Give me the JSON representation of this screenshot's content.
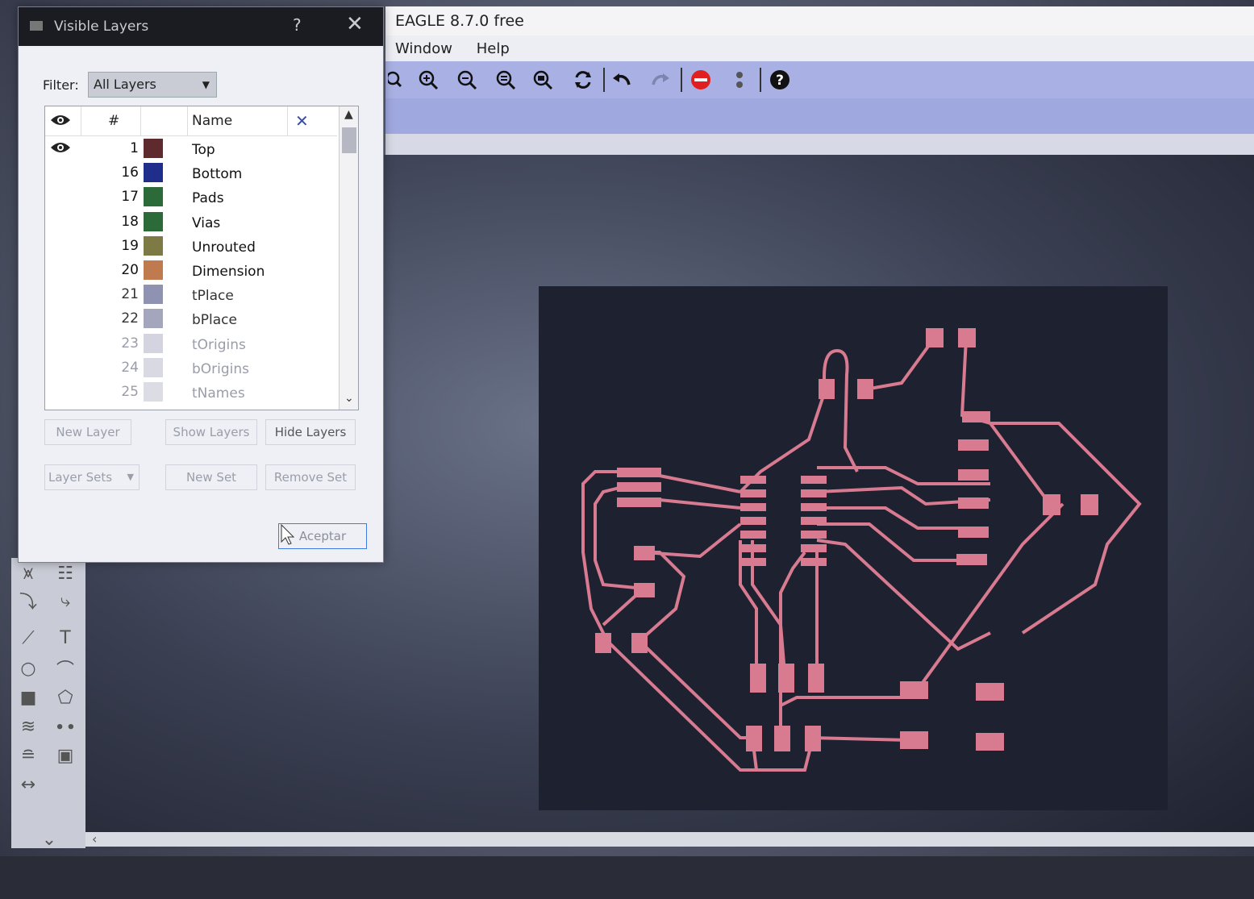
{
  "window": {
    "title": "EAGLE 8.7.0 free",
    "menu": [
      "Window",
      "Help"
    ]
  },
  "toolbar": {
    "icons": [
      "zoom-in-icon",
      "zoom-out-icon",
      "zoom-fit-icon",
      "zoom-select-icon",
      "redraw-icon",
      "undo-icon",
      "redo-icon",
      "stop-icon",
      "go-icon",
      "help-icon"
    ]
  },
  "dialog": {
    "title": "Visible Layers",
    "help": "?",
    "close": "✕",
    "filter_label": "Filter:",
    "filter_value": "All Layers",
    "columns": {
      "eye": "👁",
      "num": "#",
      "name": "Name",
      "clear": "✕"
    },
    "layers": [
      {
        "num": "1",
        "name": "Top",
        "color": "#5e2a2e",
        "visible": true
      },
      {
        "num": "16",
        "name": "Bottom",
        "color": "#1f2e8a",
        "visible": false
      },
      {
        "num": "17",
        "name": "Pads",
        "color": "#2d6a3a",
        "visible": false
      },
      {
        "num": "18",
        "name": "Vias",
        "color": "#2d6a3a",
        "visible": false
      },
      {
        "num": "19",
        "name": "Unrouted",
        "color": "#7d7a45",
        "visible": false
      },
      {
        "num": "20",
        "name": "Dimension",
        "color": "#c07a50",
        "visible": false
      },
      {
        "num": "21",
        "name": "tPlace",
        "color": "#8f92b0",
        "visible": false
      },
      {
        "num": "22",
        "name": "bPlace",
        "color": "#a4a6bd",
        "visible": false
      },
      {
        "num": "23",
        "name": "tOrigins",
        "color": "#d3d4e0",
        "visible": false
      },
      {
        "num": "24",
        "name": "bOrigins",
        "color": "#d9d9e3",
        "visible": false
      },
      {
        "num": "25",
        "name": "tNames",
        "color": "#dcdce4",
        "visible": false
      }
    ],
    "buttons": {
      "new_layer": "New Layer",
      "show_layers": "Show Layers",
      "hide_layers": "Hide Layers",
      "layer_sets": "Layer Sets",
      "new_set": "New Set",
      "remove_set": "Remove Set",
      "accept": "Aceptar"
    }
  },
  "colors": {
    "trace": "#d87a90",
    "board": "#1e2130",
    "toolbar": "#a9b1e4"
  }
}
